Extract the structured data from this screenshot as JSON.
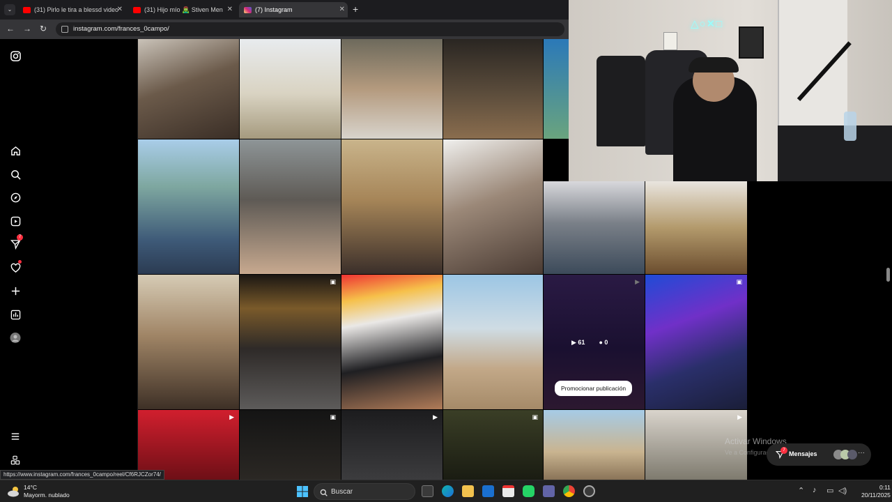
{
  "browser": {
    "tabs": [
      {
        "label": "(31) Pirlo le tira a blessd video",
        "favicon_color": "#ff0000"
      },
      {
        "label": "(31) Hijo mío 🧟‍♂️ Stiven Men",
        "favicon_color": "#ff0000"
      },
      {
        "label": "(7) Instagram",
        "favicon_color": "#e1306c"
      }
    ],
    "url": "instagram.com/frances_0campo/",
    "status_url": "https://www.instagram.com/frances_0campo/reel/Cf6RJCZor74/"
  },
  "sidebar": {
    "items": [
      {
        "name": "instagram-logo-icon",
        "glyph": "◎"
      },
      {
        "name": "home-icon",
        "glyph": "⌂"
      },
      {
        "name": "search-icon",
        "glyph": "⚲"
      },
      {
        "name": "explore-icon",
        "glyph": "⊘"
      },
      {
        "name": "reels-icon",
        "glyph": "▷"
      },
      {
        "name": "messages-icon",
        "glyph": "➤",
        "badge": "7"
      },
      {
        "name": "notifications-icon",
        "glyph": "♡"
      },
      {
        "name": "create-icon",
        "glyph": "+"
      },
      {
        "name": "dashboard-icon",
        "glyph": "▥"
      },
      {
        "name": "profile-avatar-icon",
        "glyph": "●"
      }
    ],
    "more_icon": "☰",
    "threads_icon": "⊞"
  },
  "grid": {
    "stats": {
      "plays": "61",
      "comments": "0"
    },
    "promote_label": "Promocionar publicación"
  },
  "messages_pill": {
    "label": "Mensajes",
    "badge": "7"
  },
  "watermark": {
    "line1": "Activar Windows",
    "line2": "Ve a Configuración para activar Windows."
  },
  "taskbar": {
    "weather_temp": "14°C",
    "weather_desc": "Mayorm. nublado",
    "search_placeholder": "Buscar",
    "time": "0:11",
    "date": "20/11/2025"
  }
}
